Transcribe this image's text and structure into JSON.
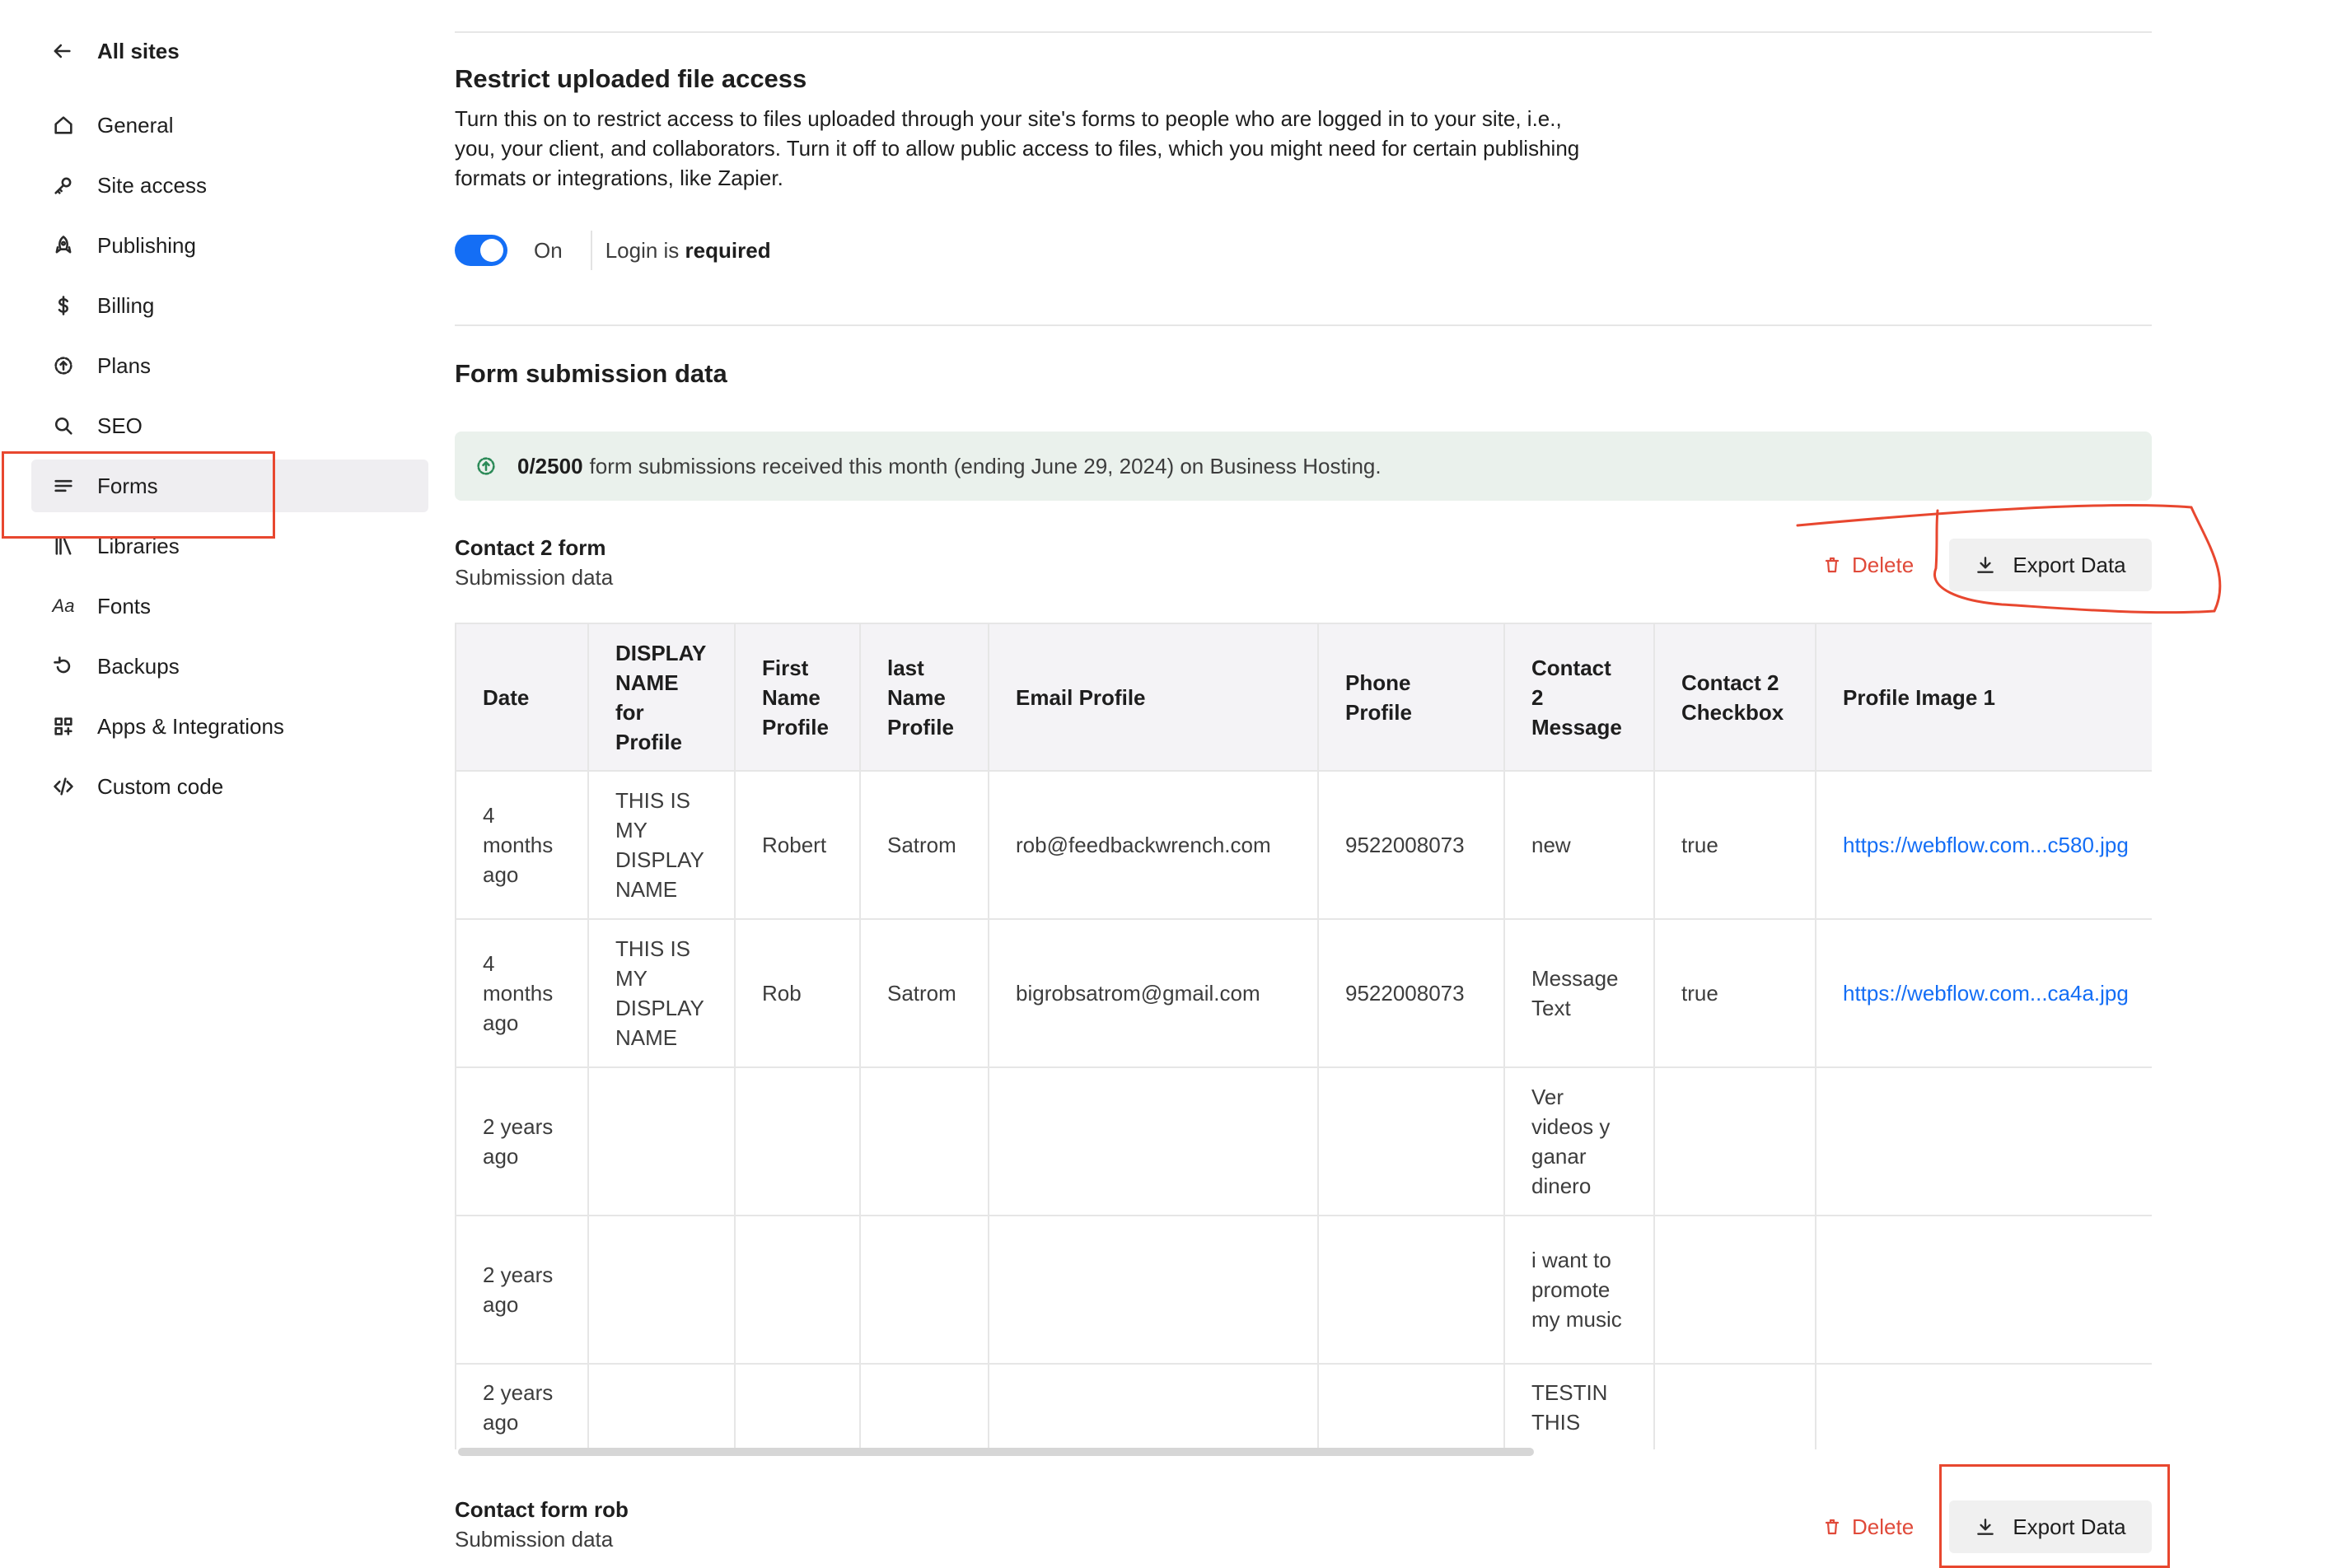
{
  "sidebar": {
    "back_label": "All sites",
    "items": [
      {
        "label": "General",
        "icon": "home-icon"
      },
      {
        "label": "Site access",
        "icon": "key-icon"
      },
      {
        "label": "Publishing",
        "icon": "rocket-icon"
      },
      {
        "label": "Billing",
        "icon": "dollar-icon"
      },
      {
        "label": "Plans",
        "icon": "plans-icon"
      },
      {
        "label": "SEO",
        "icon": "search-icon"
      },
      {
        "label": "Forms",
        "icon": "forms-icon",
        "active": true
      },
      {
        "label": "Libraries",
        "icon": "libraries-icon"
      },
      {
        "label": "Fonts",
        "icon": "fonts-icon",
        "glyph": "Aa"
      },
      {
        "label": "Backups",
        "icon": "backups-icon"
      },
      {
        "label": "Apps & Integrations",
        "icon": "apps-icon"
      },
      {
        "label": "Custom code",
        "icon": "code-icon"
      }
    ]
  },
  "restrict": {
    "title": "Restrict uploaded file access",
    "description": "Turn this on to restrict access to files uploaded through your site's forms to people who are logged in to your site, i.e., you, your client, and collaborators. Turn it off to allow public access to files, which you might need for certain publishing formats or integrations, like Zapier.",
    "toggle_state": "On",
    "login_prefix": "Login is",
    "login_emphasis": "required"
  },
  "submissions": {
    "title": "Form submission data",
    "notice_count": "0/2500",
    "notice_text": "form submissions received this month (ending June 29, 2024) on Business Hosting."
  },
  "forms": [
    {
      "title": "Contact 2 form",
      "subtitle": "Submission data",
      "delete_label": "Delete",
      "export_label": "Export Data"
    },
    {
      "title": "Contact form rob",
      "subtitle": "Submission data",
      "delete_label": "Delete",
      "export_label": "Export Data"
    }
  ],
  "table": {
    "headers": [
      "Date",
      "DISPLAY NAME for Profile",
      "First Name Profile",
      "last Name Profile",
      "Email Profile",
      "Phone Profile",
      "Contact 2 Message",
      "Contact 2 Checkbox",
      "Profile Image 1"
    ],
    "rows": [
      [
        "4 months ago",
        "THIS IS MY DISPLAY NAME",
        "Robert",
        "Satrom",
        "rob@feedbackwrench.com",
        "9522008073",
        "new",
        "true",
        "https://webflow.com...c580.jpg"
      ],
      [
        "4 months ago",
        "THIS IS MY DISPLAY NAME",
        "Rob",
        "Satrom",
        "bigrobsatrom@gmail.com",
        "9522008073",
        "Message Text",
        "true",
        "https://webflow.com...ca4a.jpg"
      ],
      [
        "2 years ago",
        "",
        "",
        "",
        "",
        "",
        "Ver videos y ganar dinero",
        "",
        ""
      ],
      [
        "2 years ago",
        "",
        "",
        "",
        "",
        "",
        "i want to promote my music",
        "",
        ""
      ],
      [
        "2 years ago",
        "",
        "",
        "",
        "",
        "",
        "TESTIN THIS",
        "",
        ""
      ]
    ]
  },
  "colors": {
    "accent": "#146ef5",
    "danger": "#e04a3a",
    "annotation": "#e8472f",
    "notice_bg": "#eaf1ec"
  }
}
